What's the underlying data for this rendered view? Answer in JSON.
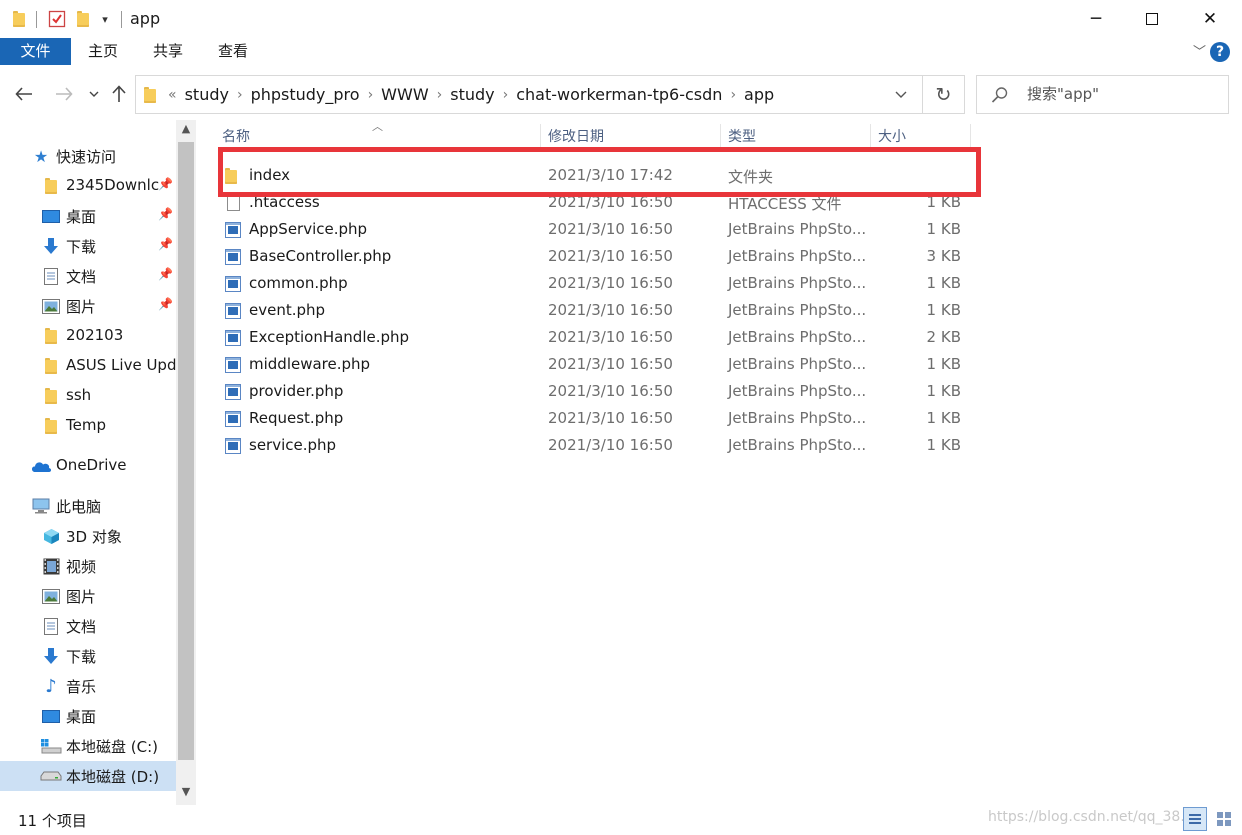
{
  "window": {
    "title": "app",
    "qat_dropdown": "▾"
  },
  "ribbon": {
    "tabs": [
      "文件",
      "主页",
      "共享",
      "查看"
    ],
    "help": "?"
  },
  "address": {
    "overflow": "«",
    "crumbs": [
      "study",
      "phpstudy_pro",
      "WWW",
      "study",
      "chat-workerman-tp6-csdn",
      "app"
    ]
  },
  "search": {
    "placeholder": "搜索\"app\""
  },
  "sidebar": {
    "quick_access": "快速访问",
    "quick_items": [
      {
        "label": "2345Downlc",
        "icon": "folder-icon",
        "pinned": true
      },
      {
        "label": "桌面",
        "icon": "desktop-icon",
        "pinned": true
      },
      {
        "label": "下载",
        "icon": "download-icon",
        "pinned": true
      },
      {
        "label": "文档",
        "icon": "document-icon",
        "pinned": true
      },
      {
        "label": "图片",
        "icon": "pictures-icon",
        "pinned": true
      },
      {
        "label": "202103",
        "icon": "folder-icon",
        "pinned": false
      },
      {
        "label": "ASUS Live Upd",
        "icon": "folder-icon",
        "pinned": false
      },
      {
        "label": "ssh",
        "icon": "folder-icon",
        "pinned": false
      },
      {
        "label": "Temp",
        "icon": "folder-icon",
        "pinned": false
      }
    ],
    "onedrive": "OneDrive",
    "this_pc": "此电脑",
    "pc_items": [
      {
        "label": "3D 对象",
        "icon": "3d-objects-icon"
      },
      {
        "label": "视频",
        "icon": "video-icon"
      },
      {
        "label": "图片",
        "icon": "pictures-icon"
      },
      {
        "label": "文档",
        "icon": "document-icon"
      },
      {
        "label": "下载",
        "icon": "download-icon"
      },
      {
        "label": "音乐",
        "icon": "music-icon"
      },
      {
        "label": "桌面",
        "icon": "desktop-icon"
      },
      {
        "label": "本地磁盘 (C:)",
        "icon": "drive-c-icon"
      },
      {
        "label": "本地磁盘 (D:)",
        "icon": "drive-icon"
      }
    ]
  },
  "list": {
    "columns": {
      "name": "名称",
      "date": "修改日期",
      "type": "类型",
      "size": "大小"
    },
    "rows": [
      {
        "name": "index",
        "date": "2021/3/10 17:42",
        "type": "文件夹",
        "size": "",
        "icon": "folder-icon"
      },
      {
        "name": ".htaccess",
        "date": "2021/3/10 16:50",
        "type": "HTACCESS 文件",
        "size": "1 KB",
        "icon": "file-icon"
      },
      {
        "name": "AppService.php",
        "date": "2021/3/10 16:50",
        "type": "JetBrains PhpSto...",
        "size": "1 KB",
        "icon": "php-file-icon"
      },
      {
        "name": "BaseController.php",
        "date": "2021/3/10 16:50",
        "type": "JetBrains PhpSto...",
        "size": "3 KB",
        "icon": "php-file-icon"
      },
      {
        "name": "common.php",
        "date": "2021/3/10 16:50",
        "type": "JetBrains PhpSto...",
        "size": "1 KB",
        "icon": "php-file-icon"
      },
      {
        "name": "event.php",
        "date": "2021/3/10 16:50",
        "type": "JetBrains PhpSto...",
        "size": "1 KB",
        "icon": "php-file-icon"
      },
      {
        "name": "ExceptionHandle.php",
        "date": "2021/3/10 16:50",
        "type": "JetBrains PhpSto...",
        "size": "2 KB",
        "icon": "php-file-icon"
      },
      {
        "name": "middleware.php",
        "date": "2021/3/10 16:50",
        "type": "JetBrains PhpSto...",
        "size": "1 KB",
        "icon": "php-file-icon"
      },
      {
        "name": "provider.php",
        "date": "2021/3/10 16:50",
        "type": "JetBrains PhpSto...",
        "size": "1 KB",
        "icon": "php-file-icon"
      },
      {
        "name": "Request.php",
        "date": "2021/3/10 16:50",
        "type": "JetBrains PhpSto...",
        "size": "1 KB",
        "icon": "php-file-icon"
      },
      {
        "name": "service.php",
        "date": "2021/3/10 16:50",
        "type": "JetBrains PhpSto...",
        "size": "1 KB",
        "icon": "php-file-icon"
      }
    ]
  },
  "status": {
    "count": "11 个项目",
    "watermark": "https://blog.csdn.net/qq_38..."
  },
  "colors": {
    "accent": "#1a66b5",
    "highlight_box": "#e8353a",
    "selected_nav": "#cce0f4"
  }
}
